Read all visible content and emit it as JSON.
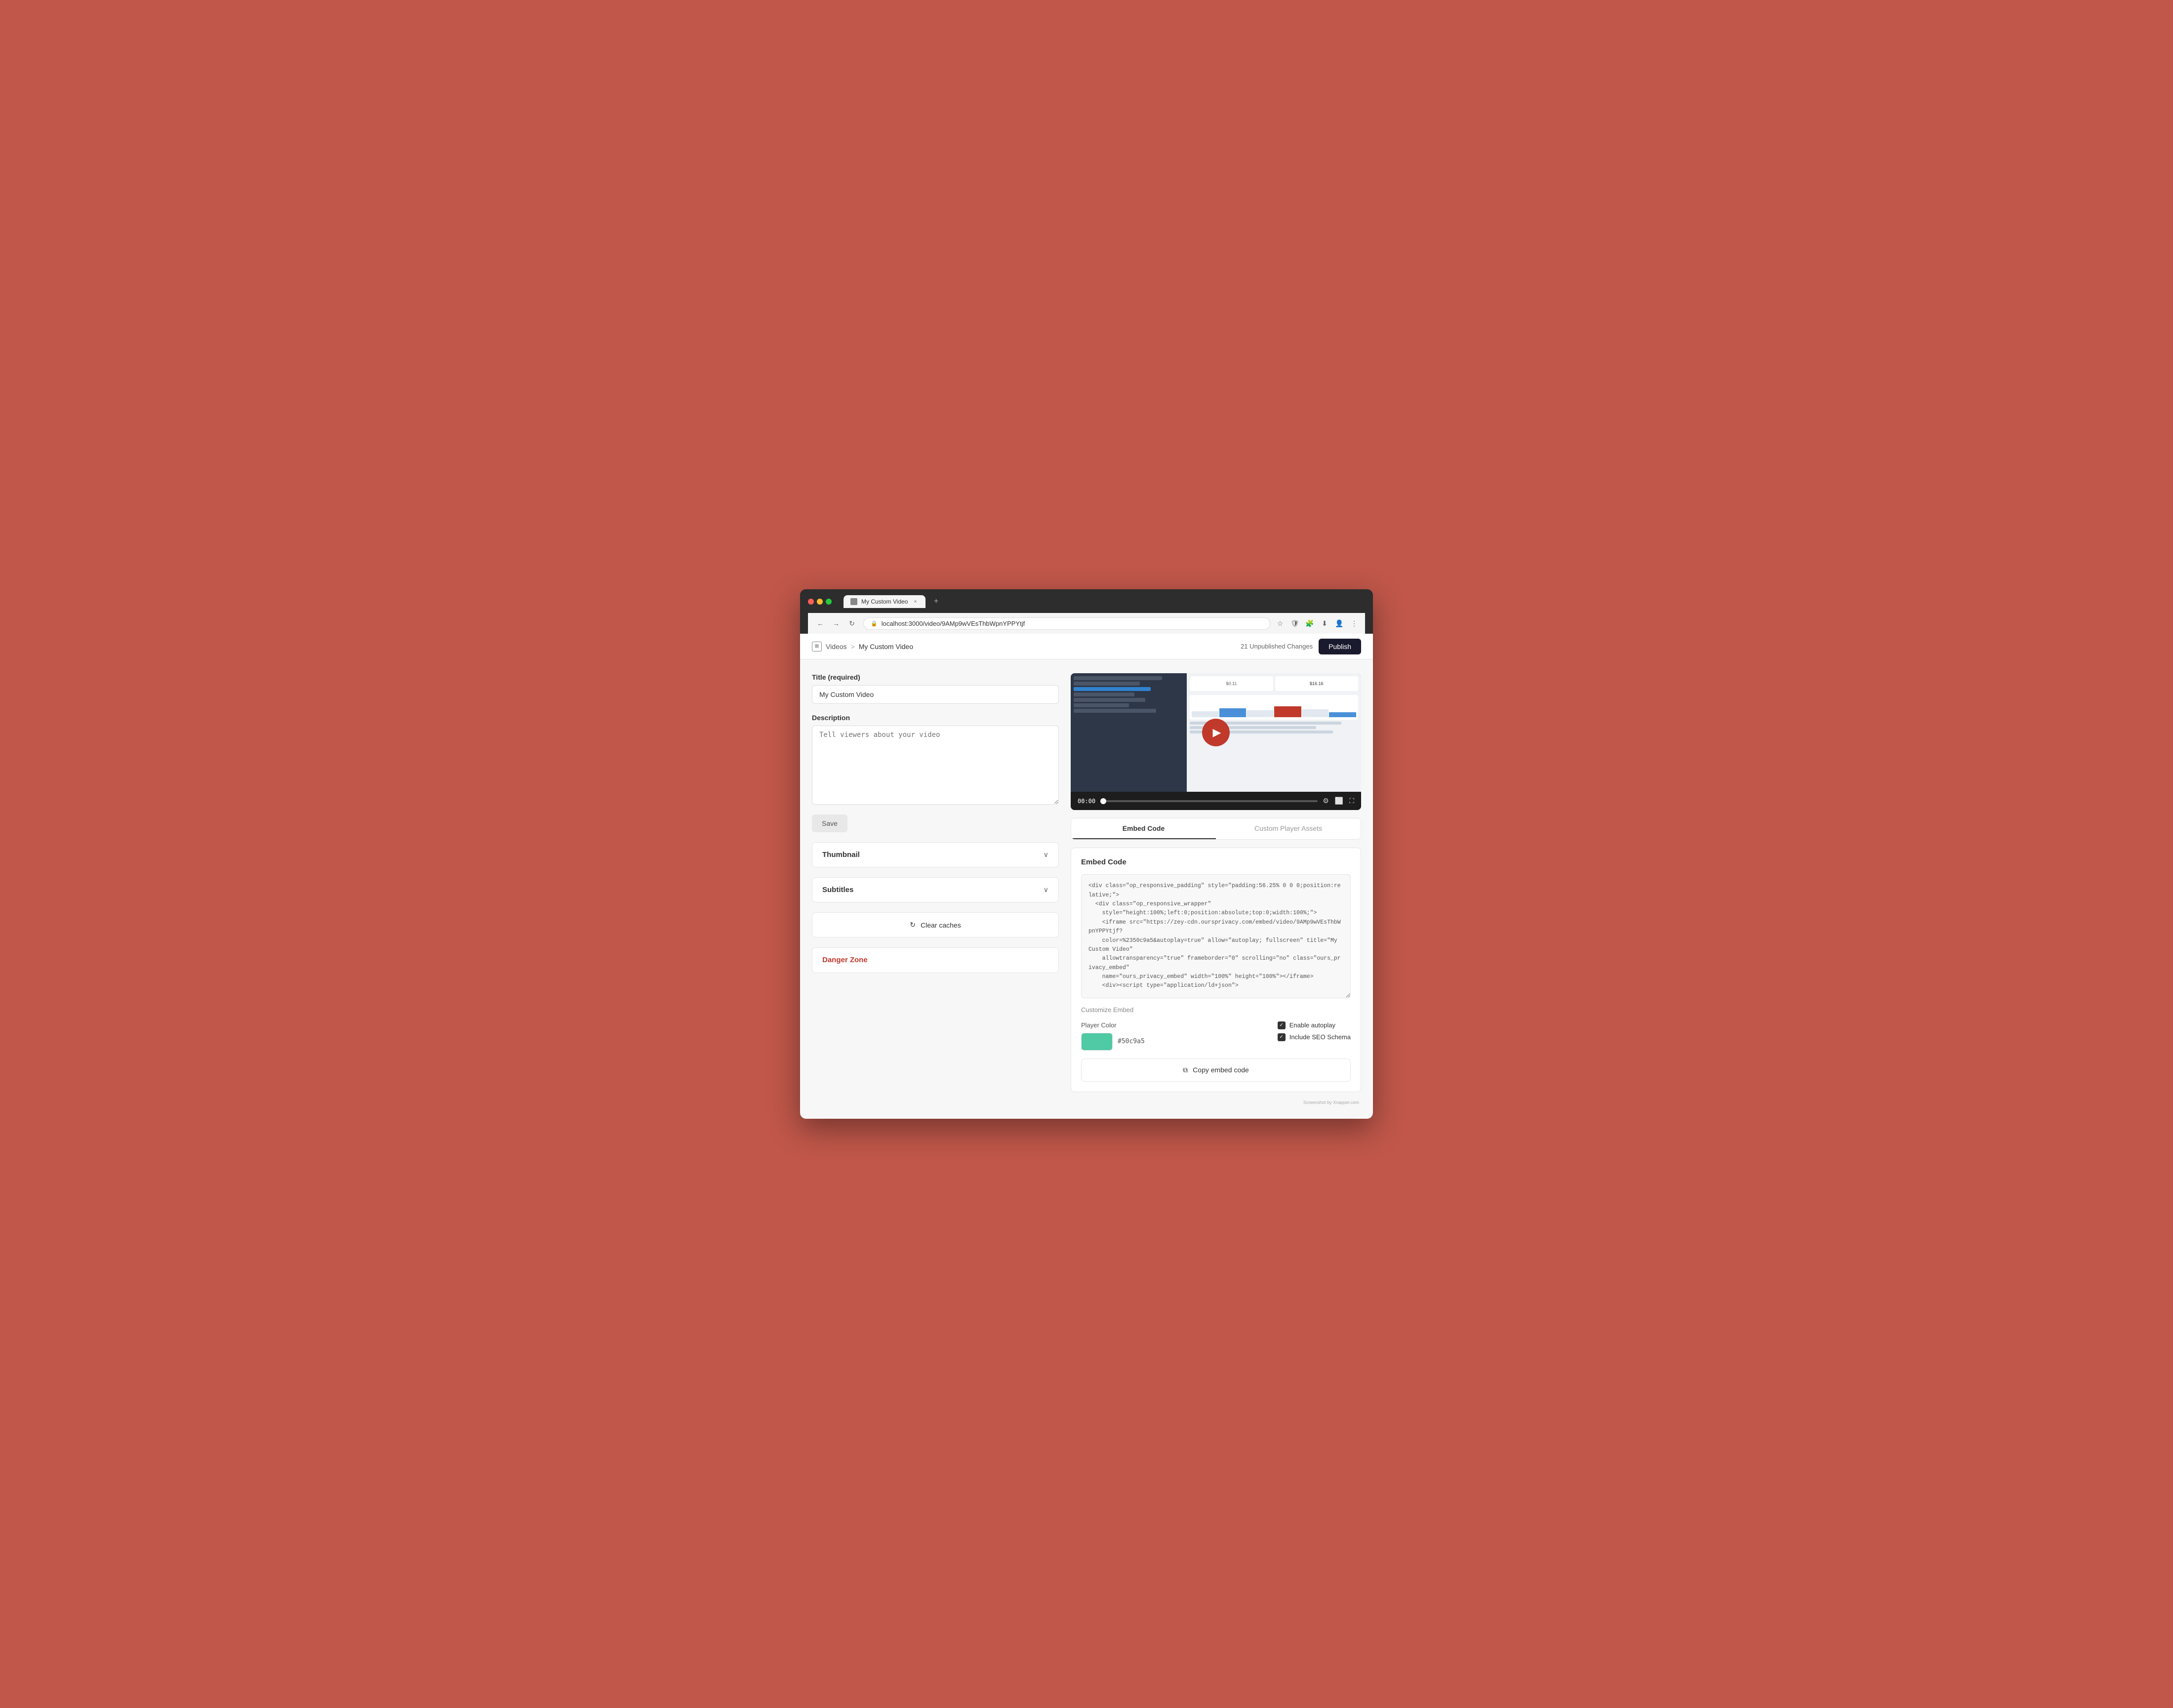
{
  "browser": {
    "tab_title": "My Custom Video",
    "url": "localhost:3000/video/9AMp9wVEsThbWpnYPPYtjf",
    "new_tab_symbol": "+",
    "close_symbol": "×"
  },
  "header": {
    "breadcrumb_icon": "□",
    "nav_videos": "Videos",
    "nav_separator": ">",
    "nav_current": "My Custom Video",
    "unpublished": "21 Unpublished Changes",
    "publish_label": "Publish"
  },
  "form": {
    "title_label": "Title (required)",
    "title_value": "My Custom Video",
    "description_label": "Description",
    "description_placeholder": "Tell viewers about your video",
    "save_label": "Save"
  },
  "sections": {
    "thumbnail_label": "Thumbnail",
    "subtitles_label": "Subtitles",
    "clear_caches_label": "Clear caches",
    "clear_caches_icon": "↻",
    "danger_zone_label": "Danger Zone"
  },
  "video": {
    "time": "00:00"
  },
  "embed": {
    "tab_embed_code": "Embed Code",
    "tab_custom_assets": "Custom Player Assets",
    "section_title": "Embed Code",
    "code_content": "<div class=\"op_responsive_padding\" style=\"padding:56.25% 0 0 0;position:relative;\">\n  <div class=\"op_responsive_wrapper\"\n    style=\"height:100%;left:0;position:absolute;top:0;width:100%;\">\n    <iframe src=\"https://zey-cdn.oursprivacy.com/embed/video/9AMp9wVEsThbWpnYPPYtjf?\n    color=%2350c9a5&autoplay=true\" allow=\"autoplay; fullscreen\" title=\"My Custom Video\"\n    allowtransparency=\"true\" frameborder=\"0\" scrolling=\"no\" class=\"ours_privacy_embed\"\n    name=\"ours_privacy_embed\" width=\"100%\" height=\"100%\"></iframe>\n    <div><script type=\"application/ld+json\">",
    "customize_label": "Customize Embed",
    "player_color_label": "Player Color",
    "color_hex": "#50c9a5",
    "color_value": "#50c9a5",
    "autoplay_label": "Enable autoplay",
    "seo_label": "Include SEO Schema",
    "copy_icon": "⧉",
    "copy_label": "Copy embed code"
  }
}
